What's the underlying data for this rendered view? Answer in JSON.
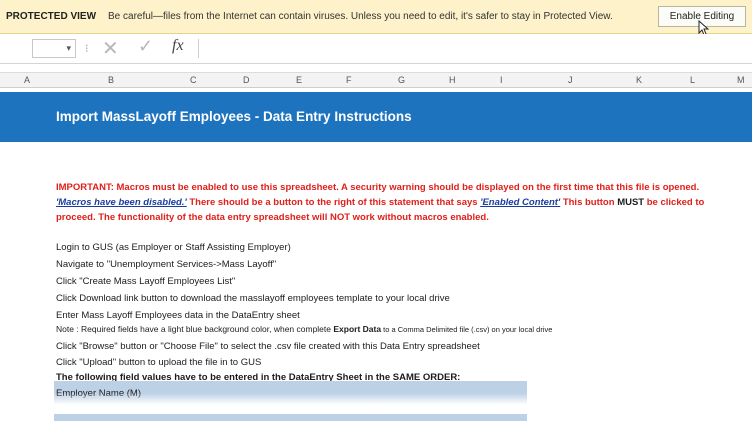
{
  "protected_view": {
    "label": "PROTECTED VIEW",
    "message": "Be careful—files from the Internet can contain viruses. Unless you need to edit, it's safer to stay in Protected View.",
    "button": "Enable Editing",
    "bar_color": "#fdf2c9"
  },
  "formula_bar": {
    "cancel_glyph": "✕",
    "enter_glyph": "✓",
    "fx_glyph": "fx",
    "separator": "⁝",
    "dropdown_glyph": "▾"
  },
  "columns": [
    "A",
    "B",
    "C",
    "D",
    "E",
    "F",
    "G",
    "H",
    "I",
    "J",
    "K",
    "L",
    "M"
  ],
  "banner": {
    "title": "Import MassLayoff Employees  - Data Entry Instructions",
    "color": "#1e73be"
  },
  "important": {
    "part1": "IMPORTANT: Macros must be enabled to use this spreadsheet. A security warning should be displayed on the first time that this file is opened.  ",
    "link1": "'Macros have been disabled.'",
    "part2": "  There should be a button to the right of this statement that says ",
    "link2": "'Enabled Content'",
    "part3": "  This button ",
    "must": "MUST",
    "part4": " be clicked to proceed. The functionality of the data entry spreadsheet will NOT work without macros enabled.",
    "color": "#e0201b"
  },
  "steps": [
    "Login to GUS (as Employer or Staff Assisting Employer)",
    "Navigate to \"Unemployment Services->Mass Layoff\"",
    "Click \"Create Mass Layoff Employees List\"",
    "Click Download link button to download the masslayoff employees template to your local drive",
    "Enter Mass Layoff Employees data in the DataEntry sheet"
  ],
  "note": {
    "prefix": "Note : Required fields have a light blue background color, when complete  ",
    "bold": "Export Data",
    "suffix": " to a Comma Delimited file (.csv)  on your local drive"
  },
  "steps2": [
    "Click \"Browse\" button or \"Choose File\" to select the .csv file created with this Data Entry spreadsheet",
    "Click \"Upload\" button to upload the file in to GUS"
  ],
  "order_heading": "The following field values have to be entered in the DataEntry Sheet in the SAME ORDER:",
  "first_field": "Employer Name (M)",
  "field_color": "#bcd0e6"
}
